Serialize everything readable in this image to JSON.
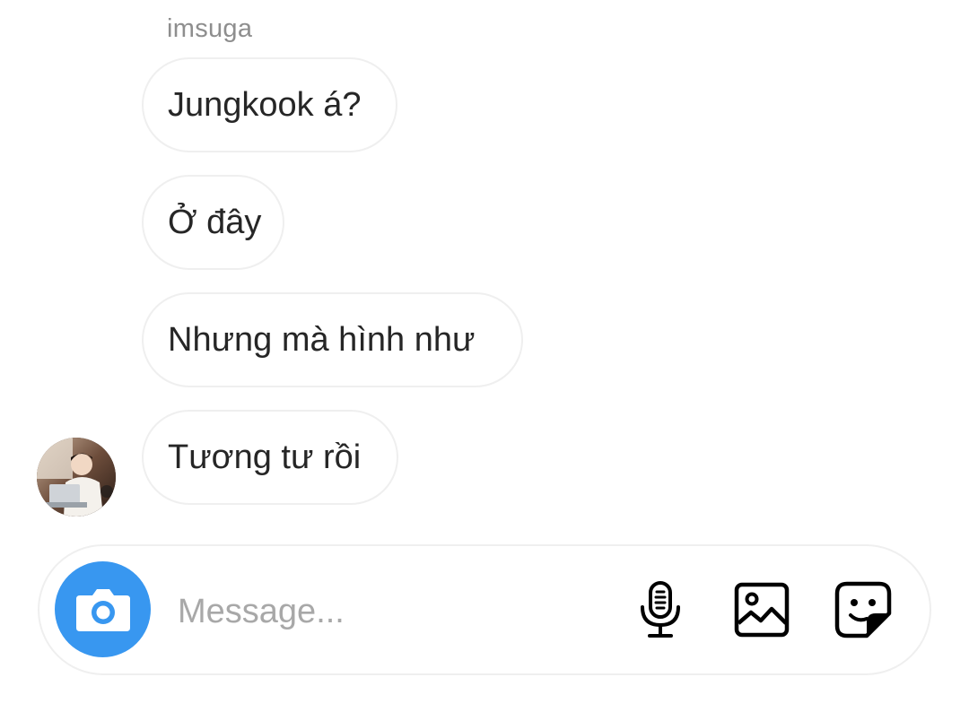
{
  "thread": {
    "sender_name": "imsuga",
    "messages": [
      {
        "text": "Jungkook á?"
      },
      {
        "text": "Ở đây"
      },
      {
        "text": "Nhưng mà hình như"
      },
      {
        "text": "Tương tư rồi"
      }
    ]
  },
  "composer": {
    "placeholder": "Message...",
    "value": "",
    "icons": [
      "camera-icon",
      "microphone-icon",
      "gallery-icon",
      "sticker-icon"
    ],
    "camera_button_color": "#3897f0"
  },
  "colors": {
    "bubble_border": "#efefef",
    "text": "#262626",
    "secondary_text": "#8e8e8e",
    "placeholder": "#a8a8a8"
  }
}
